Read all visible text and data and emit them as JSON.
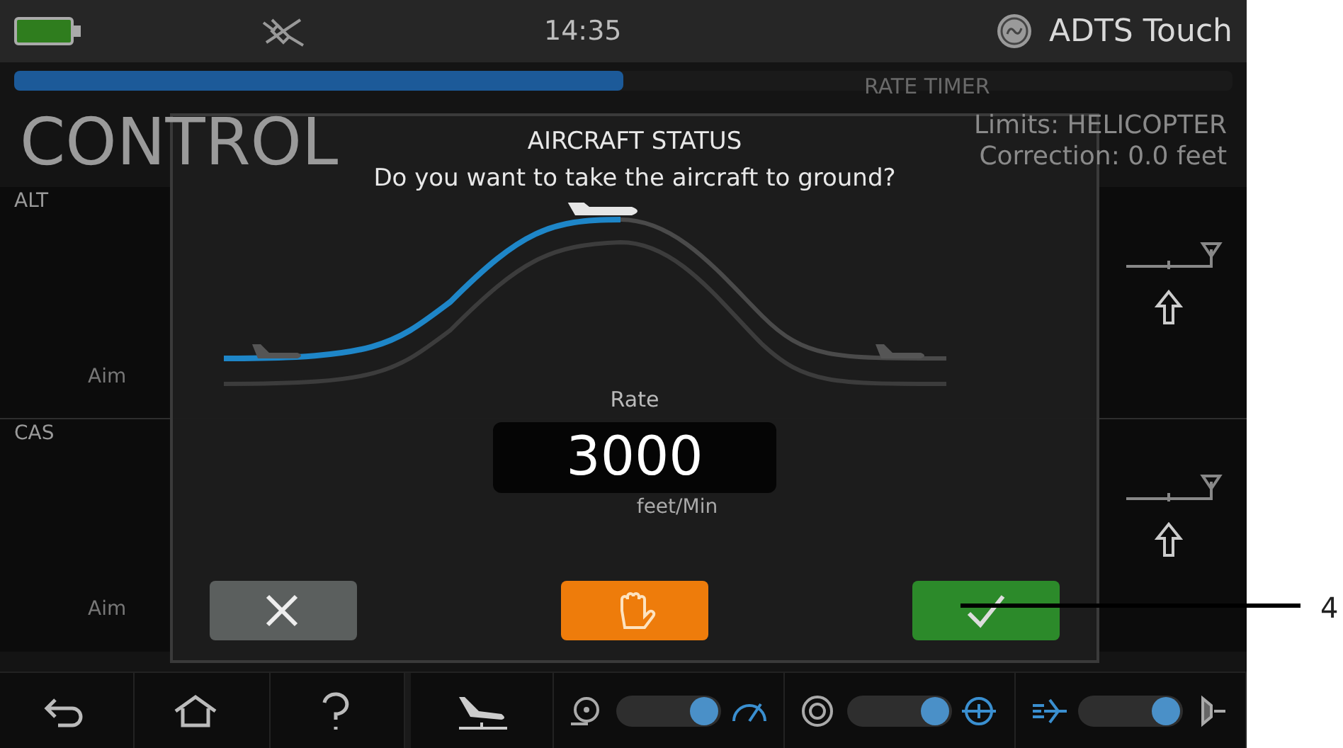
{
  "status_bar": {
    "time": "14:35",
    "brand": "ADTS Touch"
  },
  "timer": {
    "label": "RATE TIMER",
    "level": 0.5
  },
  "background": {
    "title": "CONTROL",
    "limits": "Limits: HELICOPTER",
    "correction": "Correction: 0.0 feet",
    "channels": [
      {
        "name": "ALT",
        "aim_label": "Aim"
      },
      {
        "name": "CAS",
        "aim_label": "Aim"
      }
    ]
  },
  "dialog": {
    "title": "AIRCRAFT STATUS",
    "message": "Do you want to take the aircraft to ground?",
    "rate_label": "Rate",
    "rate_value": "3000",
    "rate_unit": "feet/Min",
    "buttons": [
      {
        "kind": "cancel"
      },
      {
        "kind": "hold"
      },
      {
        "kind": "confirm"
      }
    ]
  },
  "nav": {
    "buttons": [
      {
        "kind": "back"
      },
      {
        "kind": "home"
      },
      {
        "kind": "help"
      },
      {
        "kind": "landing"
      }
    ],
    "toggles": [
      {
        "kind": "gauge",
        "on": true
      },
      {
        "kind": "attitude",
        "on": true
      },
      {
        "kind": "flight",
        "on": true
      }
    ]
  },
  "callout": "4"
}
